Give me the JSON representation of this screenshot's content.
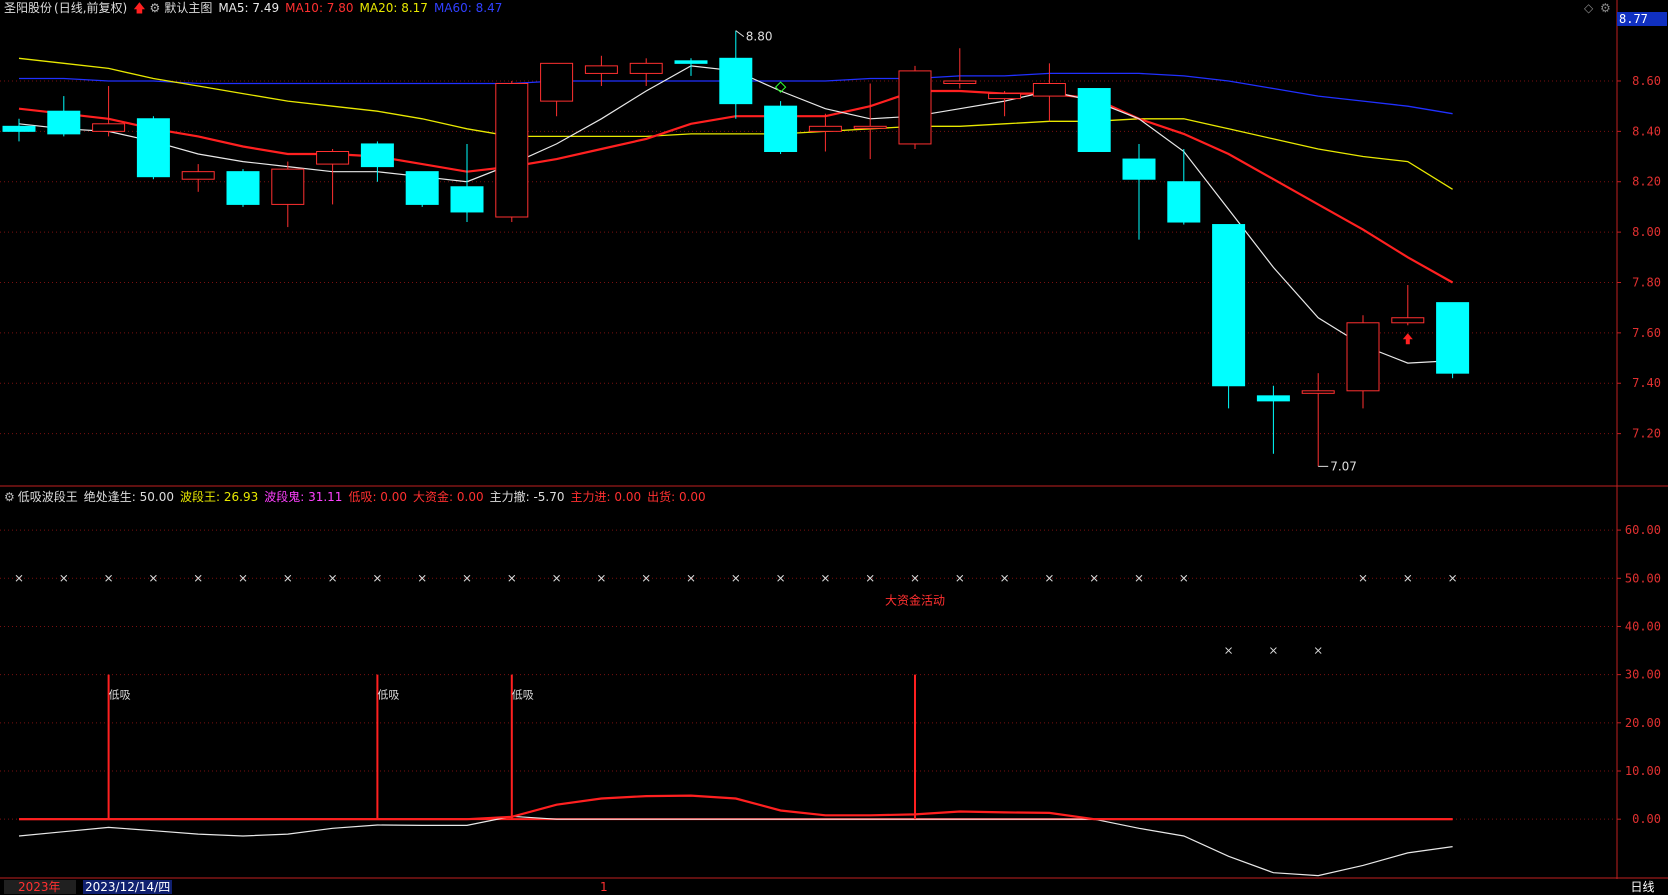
{
  "header": {
    "stock_name": "圣阳股份",
    "period": "(日线,前复权)",
    "main_chart_name": "默认主图",
    "ma5": "MA5: 7.49",
    "ma10": "MA10: 7.80",
    "ma20": "MA20: 8.17",
    "ma60": "MA60: 8.47",
    "corner_price": "8.77"
  },
  "colors": {
    "up": "#ff3030",
    "down": "#00ffff",
    "ma5": "#e8e8e8",
    "ma10": "#ff2020",
    "ma20": "#e8e800",
    "ma60": "#2030ff",
    "grid": "#7a1010"
  },
  "sub_header": {
    "indicator_name": "低吸波段王",
    "jue": "绝处逢生: 50.00",
    "bdw": "波段王: 26.93",
    "bdg": "波段鬼: 31.11",
    "dixi": "低吸: 0.00",
    "dzj": "大资金: 0.00",
    "zlc": "主力撤: -5.70",
    "zlj": "主力进: 0.00",
    "ch": "出货: 0.00"
  },
  "annotations": {
    "high_label": "8.80",
    "low_label": "7.07",
    "big_money_label": "大资金活动",
    "dixi_label": "低吸"
  },
  "bottom_bar": {
    "year": "2023年",
    "date": "2023/12/14/四",
    "marker": "1",
    "period_button": "日线"
  },
  "chart_data": [
    {
      "type": "candlestick",
      "y_axis_ticks": [
        "8.60",
        "8.40",
        "8.20",
        "8.00",
        "7.80",
        "7.60",
        "7.40",
        "7.20"
      ],
      "ylim": [
        7.0,
        8.85
      ],
      "candles": [
        {
          "o": 8.42,
          "h": 8.45,
          "l": 8.36,
          "c": 8.4
        },
        {
          "o": 8.48,
          "h": 8.54,
          "l": 8.38,
          "c": 8.39
        },
        {
          "o": 8.4,
          "h": 8.58,
          "l": 8.38,
          "c": 8.43
        },
        {
          "o": 8.45,
          "h": 8.46,
          "l": 8.21,
          "c": 8.22
        },
        {
          "o": 8.21,
          "h": 8.27,
          "l": 8.16,
          "c": 8.24
        },
        {
          "o": 8.24,
          "h": 8.25,
          "l": 8.1,
          "c": 8.11
        },
        {
          "o": 8.11,
          "h": 8.28,
          "l": 8.02,
          "c": 8.25
        },
        {
          "o": 8.27,
          "h": 8.33,
          "l": 8.11,
          "c": 8.32
        },
        {
          "o": 8.35,
          "h": 8.36,
          "l": 8.2,
          "c": 8.26
        },
        {
          "o": 8.24,
          "h": 8.24,
          "l": 8.1,
          "c": 8.11
        },
        {
          "o": 8.18,
          "h": 8.35,
          "l": 8.04,
          "c": 8.08
        },
        {
          "o": 8.06,
          "h": 8.6,
          "l": 8.04,
          "c": 8.59
        },
        {
          "o": 8.52,
          "h": 8.67,
          "l": 8.46,
          "c": 8.67
        },
        {
          "o": 8.63,
          "h": 8.7,
          "l": 8.58,
          "c": 8.66
        },
        {
          "o": 8.63,
          "h": 8.69,
          "l": 8.58,
          "c": 8.67
        },
        {
          "o": 8.68,
          "h": 8.69,
          "l": 8.62,
          "c": 8.67
        },
        {
          "o": 8.69,
          "h": 8.8,
          "l": 8.45,
          "c": 8.51
        },
        {
          "o": 8.5,
          "h": 8.52,
          "l": 8.31,
          "c": 8.32
        },
        {
          "o": 8.4,
          "h": 8.47,
          "l": 8.32,
          "c": 8.42
        },
        {
          "o": 8.42,
          "h": 8.59,
          "l": 8.29,
          "c": 8.42
        },
        {
          "o": 8.35,
          "h": 8.66,
          "l": 8.33,
          "c": 8.64
        },
        {
          "o": 8.59,
          "h": 8.73,
          "l": 8.57,
          "c": 8.6
        },
        {
          "o": 8.53,
          "h": 8.56,
          "l": 8.46,
          "c": 8.55
        },
        {
          "o": 8.54,
          "h": 8.67,
          "l": 8.44,
          "c": 8.59
        },
        {
          "o": 8.57,
          "h": 8.57,
          "l": 8.32,
          "c": 8.32
        },
        {
          "o": 8.29,
          "h": 8.35,
          "l": 7.97,
          "c": 8.21
        },
        {
          "o": 8.2,
          "h": 8.33,
          "l": 8.03,
          "c": 8.04
        },
        {
          "o": 8.03,
          "h": 8.03,
          "l": 7.3,
          "c": 7.39
        },
        {
          "o": 7.35,
          "h": 7.39,
          "l": 7.12,
          "c": 7.33
        },
        {
          "o": 7.36,
          "h": 7.44,
          "l": 7.07,
          "c": 7.37
        },
        {
          "o": 7.37,
          "h": 7.67,
          "l": 7.3,
          "c": 7.64
        },
        {
          "o": 7.64,
          "h": 7.79,
          "l": 7.63,
          "c": 7.66
        },
        {
          "o": 7.72,
          "h": 7.72,
          "l": 7.42,
          "c": 7.44
        }
      ],
      "ma5": [
        8.43,
        8.41,
        8.4,
        8.36,
        8.31,
        8.28,
        8.26,
        8.24,
        8.24,
        8.22,
        8.2,
        8.27,
        8.35,
        8.45,
        8.56,
        8.66,
        8.64,
        8.56,
        8.49,
        8.45,
        8.46,
        8.49,
        8.52,
        8.56,
        8.52,
        8.45,
        8.32,
        8.09,
        7.86,
        7.66,
        7.55,
        7.48,
        7.49
      ],
      "ma10": [
        8.49,
        8.47,
        8.45,
        8.41,
        8.38,
        8.34,
        8.31,
        8.31,
        8.3,
        8.27,
        8.24,
        8.26,
        8.29,
        8.33,
        8.37,
        8.43,
        8.46,
        8.46,
        8.46,
        8.5,
        8.56,
        8.56,
        8.55,
        8.55,
        8.53,
        8.45,
        8.39,
        8.31,
        8.21,
        8.11,
        8.01,
        7.9,
        7.8
      ],
      "ma20": [
        8.69,
        8.67,
        8.65,
        8.61,
        8.58,
        8.55,
        8.52,
        8.5,
        8.48,
        8.45,
        8.41,
        8.38,
        8.38,
        8.38,
        8.38,
        8.39,
        8.39,
        8.39,
        8.4,
        8.41,
        8.42,
        8.42,
        8.43,
        8.44,
        8.44,
        8.45,
        8.45,
        8.41,
        8.37,
        8.33,
        8.3,
        8.28,
        8.17
      ],
      "ma60": [
        8.61,
        8.61,
        8.6,
        8.6,
        8.59,
        8.59,
        8.59,
        8.59,
        8.59,
        8.59,
        8.59,
        8.59,
        8.6,
        8.6,
        8.6,
        8.6,
        8.6,
        8.6,
        8.6,
        8.61,
        8.61,
        8.62,
        8.62,
        8.63,
        8.63,
        8.63,
        8.62,
        8.6,
        8.57,
        8.54,
        8.52,
        8.5,
        8.47
      ]
    },
    {
      "type": "line",
      "y_axis_ticks": [
        "60.00",
        "50.00",
        "40.00",
        "30.00",
        "20.00",
        "10.00",
        "0.00"
      ],
      "ylim": [
        -12,
        65
      ],
      "x_marks_50": [
        0,
        1,
        2,
        3,
        4,
        5,
        6,
        7,
        8,
        9,
        10,
        11,
        12,
        13,
        14,
        15,
        16,
        17,
        18,
        19,
        20,
        21,
        22,
        23,
        24,
        25,
        26,
        30,
        31,
        32
      ],
      "x_marks_35": [
        27,
        28,
        29
      ],
      "red_line": [
        0,
        0,
        0,
        0,
        0,
        0,
        0,
        0,
        0,
        0,
        0,
        0.5,
        3,
        4.3,
        4.8,
        4.9,
        4.3,
        1.8,
        0.8,
        0.8,
        1,
        1.6,
        1.4,
        1.3,
        0,
        0,
        0,
        0,
        0,
        0,
        0,
        0,
        0
      ],
      "white_line": [
        -3.5,
        -2.6,
        -1.7,
        -2.4,
        -3.1,
        -3.5,
        -3.1,
        -1.9,
        -1.2,
        -1.3,
        -1.3,
        0.6,
        0,
        0,
        0,
        0,
        0,
        0,
        0,
        0,
        0,
        0,
        0,
        0,
        0,
        -1.9,
        -3.5,
        -7.7,
        -11.1,
        -11.7,
        -9.6,
        -7,
        -5.7
      ],
      "spikes": [
        {
          "i": 2,
          "v": 30,
          "label": true
        },
        {
          "i": 8,
          "v": 30,
          "label": true
        },
        {
          "i": 11,
          "v": 30,
          "label": true
        },
        {
          "i": 20,
          "v": 30,
          "label": false
        }
      ]
    }
  ]
}
